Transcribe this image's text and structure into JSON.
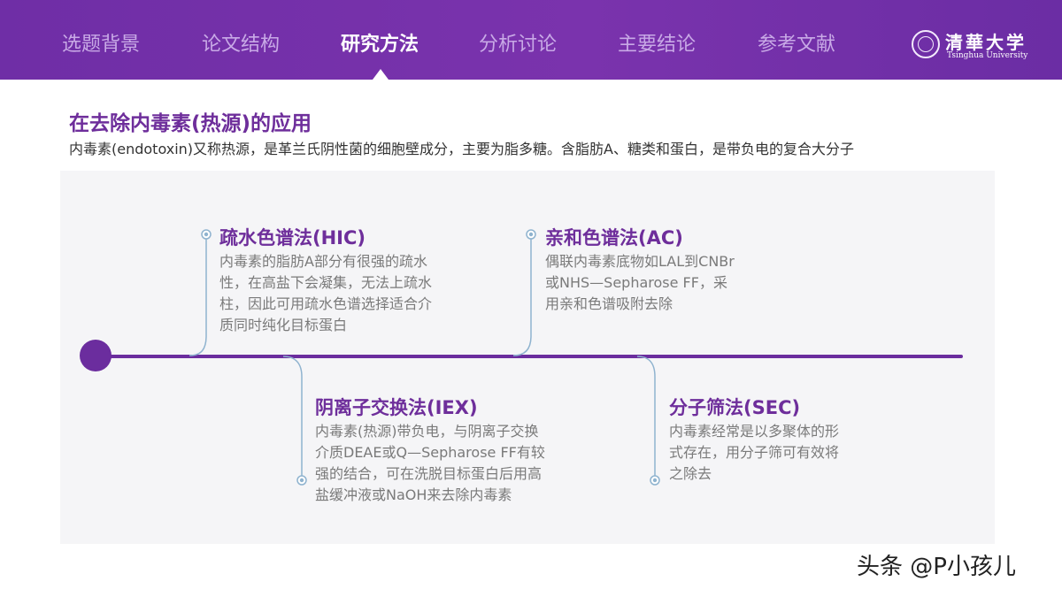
{
  "nav": {
    "items": [
      {
        "label": "选题背景",
        "active": false
      },
      {
        "label": "论文结构",
        "active": false
      },
      {
        "label": "研究方法",
        "active": true
      },
      {
        "label": "分析讨论",
        "active": false
      },
      {
        "label": "主要结论",
        "active": false
      },
      {
        "label": "参考文献",
        "active": false
      }
    ]
  },
  "logo": {
    "cn": "清華大学",
    "en": "Tsinghua University"
  },
  "section": {
    "title": "在去除内毒素(热源)的应用",
    "description": "内毒素(endotoxin)又称热源，是革兰氏阴性菌的细胞壁成分，主要为脂多糖。含脂肪A、糖类和蛋白，是带负电的复合大分子"
  },
  "methods": [
    {
      "title": "疏水色谱法(HIC)",
      "lines": [
        "内毒素的脂肪A部分有很强的疏水",
        "性，在高盐下会凝集，无法上疏水",
        "柱，因此可用疏水色谱选择适合介",
        "质同时纯化目标蛋白"
      ]
    },
    {
      "title": "阴离子交换法(IEX)",
      "lines": [
        "内毒素(热源)带负电，与阴离子交换",
        "介质DEAE或Q—Sepharose FF有较",
        "强的结合，可在洗脱目标蛋白后用高",
        "盐缓冲液或NaOH来去除内毒素"
      ]
    },
    {
      "title": "亲和色谱法(AC)",
      "lines": [
        "偶联内毒素底物如LAL到CNBr",
        "或NHS—Sepharose FF，采",
        "用亲和色谱吸附去除"
      ]
    },
    {
      "title": "分子筛法(SEC)",
      "lines": [
        "内毒素经常是以多聚体的形",
        "式存在，用分子筛可有效将",
        "之除去"
      ]
    }
  ],
  "colors": {
    "brand": "#7a33ad",
    "title": "#6e2e9b",
    "timeline": "#6b2d9e",
    "connector": "#8fb3cf"
  },
  "watermark": "头条 @P小孩儿"
}
